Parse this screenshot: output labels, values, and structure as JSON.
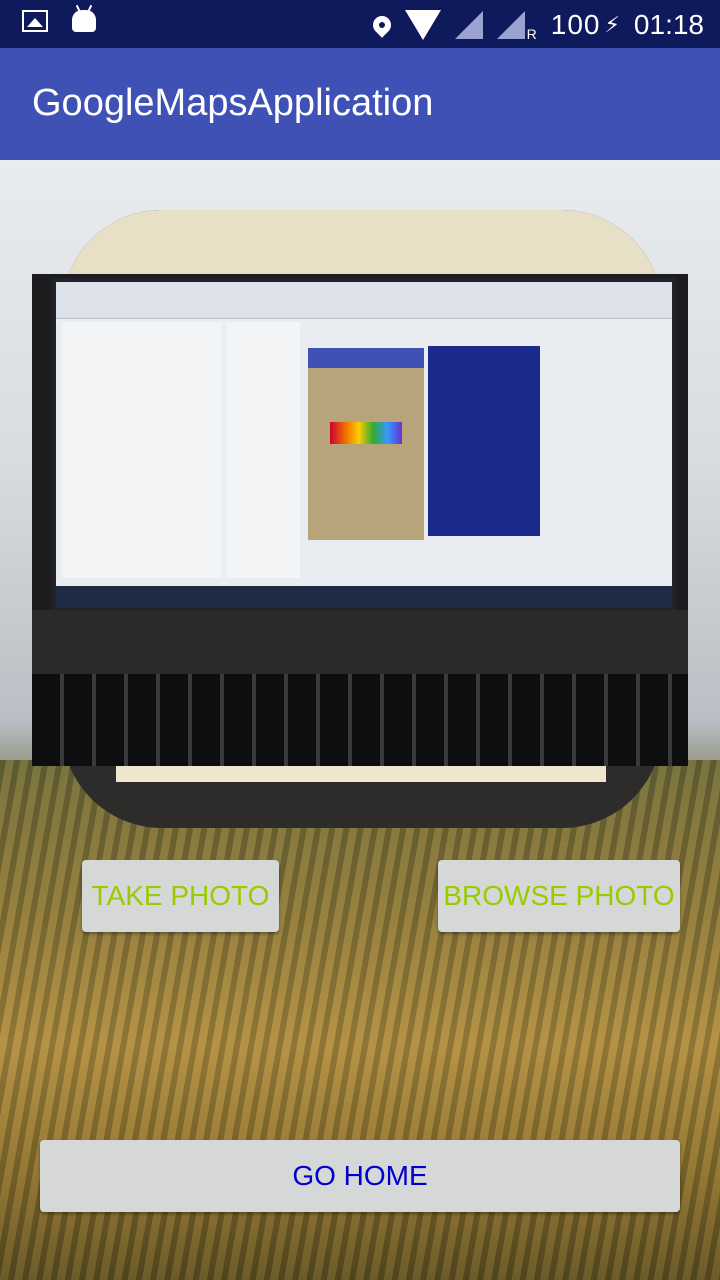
{
  "status_bar": {
    "battery": "100",
    "time": "01:18",
    "network_mark": "R",
    "icons": [
      "gallery-icon",
      "android-icon",
      "location-pin-icon",
      "wifi-icon",
      "signal-icon",
      "signal-roaming-icon",
      "charging-bolt-icon"
    ]
  },
  "app_bar": {
    "title": "GoogleMapsApplication",
    "color": "#3f51b5"
  },
  "buttons": {
    "take_photo": "TAKE PHOTO",
    "browse_photo": "BROWSE PHOTO",
    "go_home": "GO HOME"
  },
  "colors": {
    "status_bar": "#0e1a5c",
    "photo_buttons_text": "#99cc00",
    "home_button_text": "#0000cc",
    "button_bg": "#d6d7d7"
  }
}
